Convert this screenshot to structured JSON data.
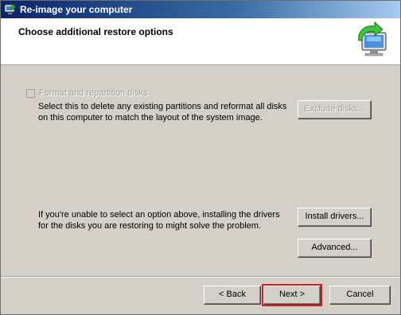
{
  "window": {
    "title": "Re-image your computer",
    "app_icon": "reimage-app-icon"
  },
  "header": {
    "heading": "Choose additional restore options",
    "icon": "computer-restore-icon"
  },
  "options": {
    "format_checkbox_label": "Format and repartition disks",
    "format_checkbox_checked": false,
    "format_checkbox_enabled": false,
    "format_description": "Select this to delete any existing partitions and reformat all disks on this computer to match the layout of the system image.",
    "exclude_disks_label": "Exclude disks...",
    "drivers_description": "If you're unable to select an option above, installing the drivers for the disks you are restoring to might solve the problem.",
    "install_drivers_label": "Install drivers...",
    "advanced_label": "Advanced..."
  },
  "footer": {
    "back_label": "< Back",
    "next_label": "Next >",
    "cancel_label": "Cancel"
  },
  "colors": {
    "dialog_bg": "#d4d0c8",
    "title_bar_start": "#0a246a",
    "title_bar_end": "#a6caf0",
    "highlight": "#e0161b"
  }
}
